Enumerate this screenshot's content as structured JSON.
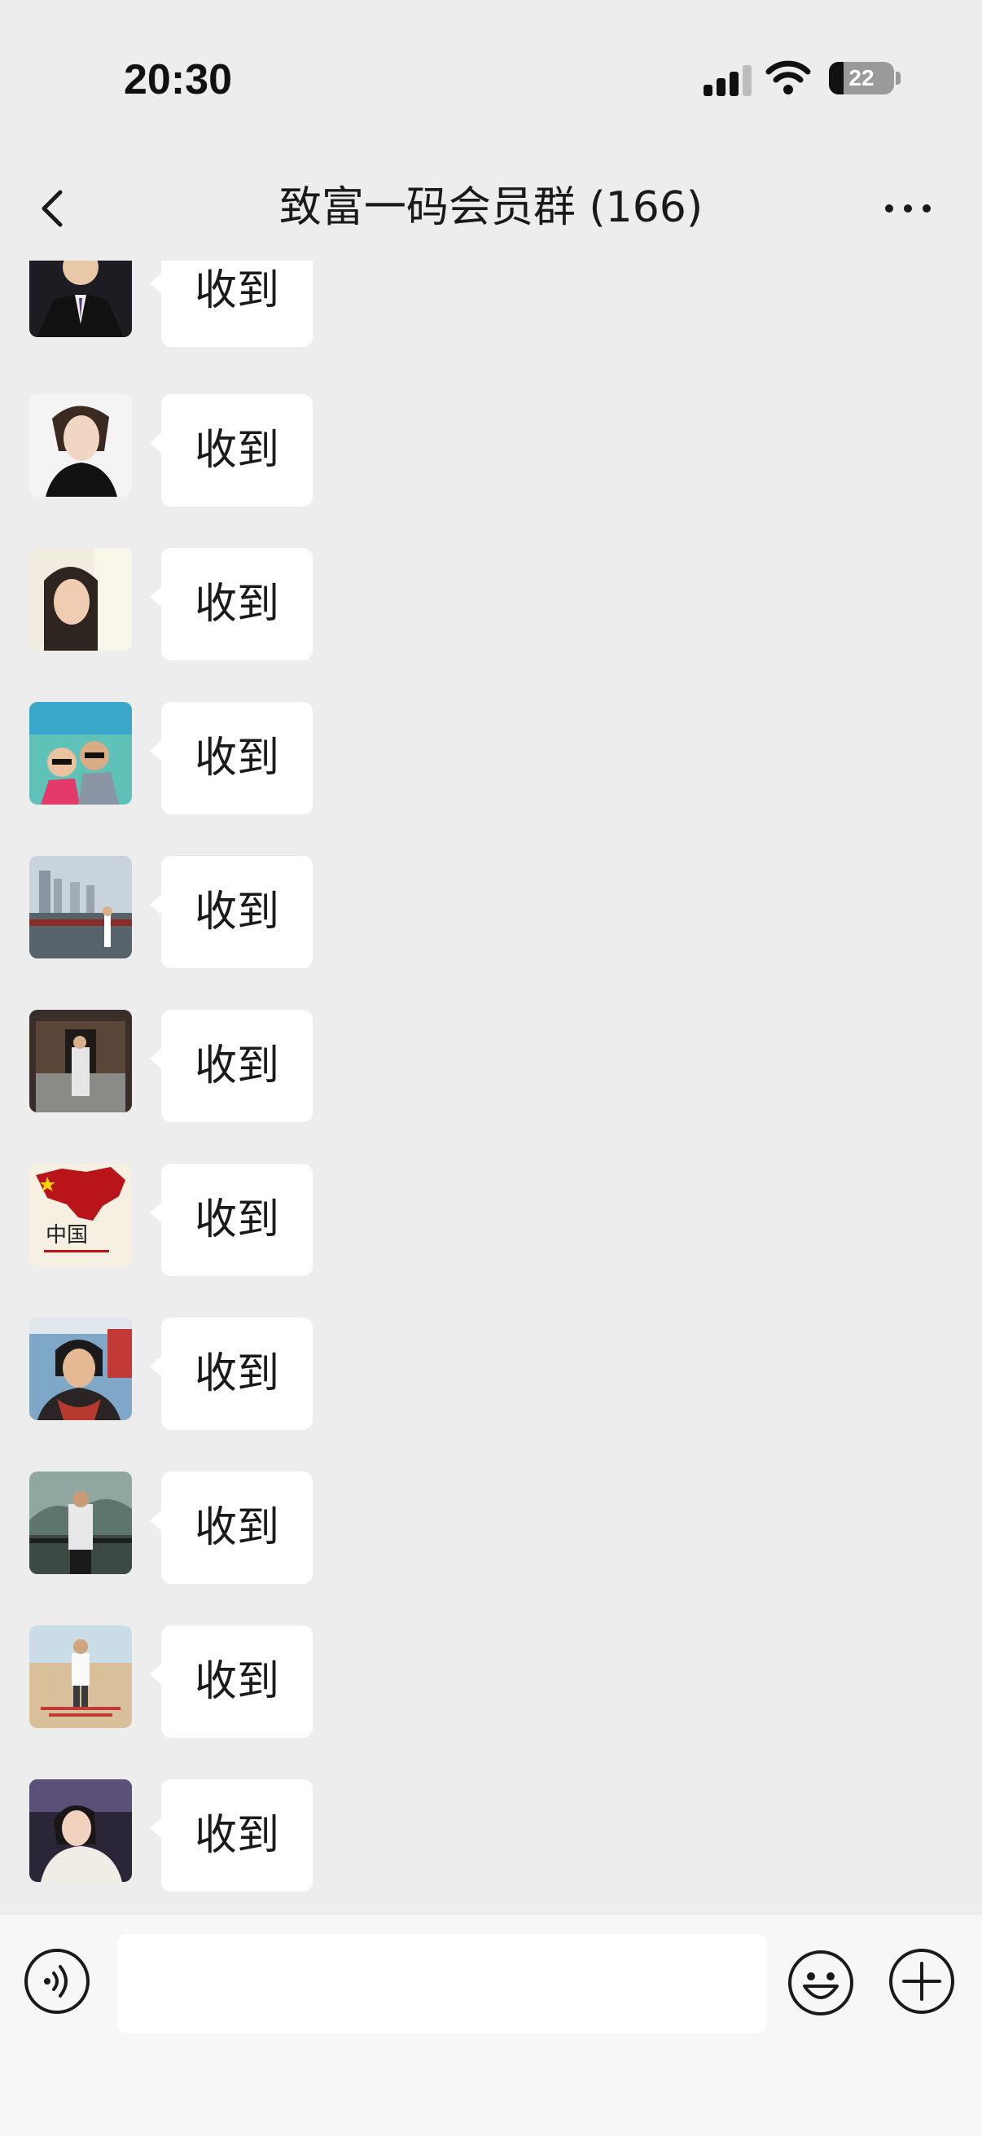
{
  "status_bar": {
    "time": "20:30",
    "battery_level": "22",
    "battery_fraction": 0.22
  },
  "header": {
    "title": "致富一码会员群 (166)",
    "back_icon": "chevron-left-icon",
    "more_icon": "more-dots-icon"
  },
  "messages": [
    {
      "text": "收到",
      "avatar": "man-in-suit"
    },
    {
      "text": "收到",
      "avatar": "woman-portrait"
    },
    {
      "text": "收到",
      "avatar": "woman-selfie"
    },
    {
      "text": "收到",
      "avatar": "couple-beach"
    },
    {
      "text": "收到",
      "avatar": "city-riverside"
    },
    {
      "text": "收到",
      "avatar": "temple-gate"
    },
    {
      "text": "收到",
      "avatar": "china-map",
      "avatar_text": "中国"
    },
    {
      "text": "收到",
      "avatar": "woman-station"
    },
    {
      "text": "收到",
      "avatar": "man-mountains"
    },
    {
      "text": "收到",
      "avatar": "man-beach"
    },
    {
      "text": "收到",
      "avatar": "woman-car"
    }
  ],
  "input_bar": {
    "voice_icon": "voice-icon",
    "emoji_icon": "emoji-icon",
    "plus_icon": "plus-circle-icon",
    "input_value": ""
  },
  "colors": {
    "background": "#ededed",
    "bubble": "#ffffff",
    "text": "#1a1a1a"
  }
}
